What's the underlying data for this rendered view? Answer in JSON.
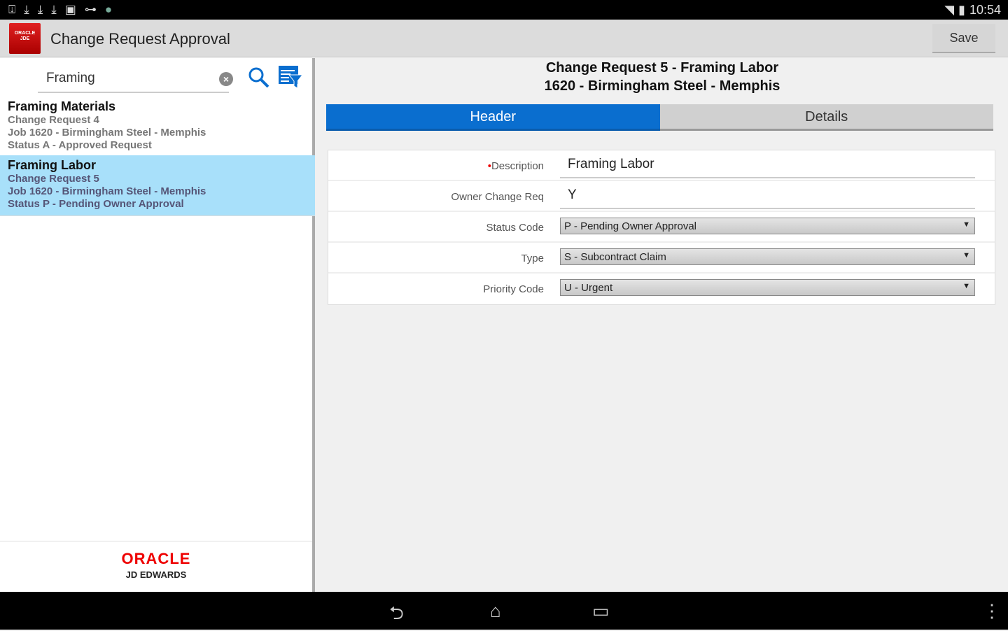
{
  "status_bar": {
    "time": "10:54",
    "icons": [
      "download-box-icon",
      "download-icon",
      "download-icon",
      "download-icon",
      "image-icon",
      "key-icon",
      "globe-icon"
    ]
  },
  "app": {
    "title": "Change Request Approval",
    "logo_text": "ORACLE JD EDWARDS ENTERPRISEONE",
    "save_label": "Save"
  },
  "search": {
    "value": "Framing"
  },
  "list": [
    {
      "title": "Framing Materials",
      "line1": "Change Request 4",
      "line2": "Job 1620 - Birmingham Steel - Memphis",
      "line3": "Status A - Approved Request",
      "selected": false
    },
    {
      "title": "Framing Labor",
      "line1": "Change Request 5",
      "line2": "Job 1620 - Birmingham Steel - Memphis",
      "line3": "Status P - Pending Owner Approval",
      "selected": true
    }
  ],
  "footer": {
    "brand": "ORACLE",
    "sub": "JD EDWARDS"
  },
  "detail": {
    "title1": "Change Request 5 - Framing Labor",
    "title2": "1620 - Birmingham Steel - Memphis",
    "tabs": [
      {
        "label": "Header"
      },
      {
        "label": "Details"
      }
    ],
    "fields": {
      "description": {
        "label": "Description",
        "value": "Framing Labor"
      },
      "owner": {
        "label": "Owner Change Req",
        "value": "Y"
      },
      "status": {
        "label": "Status Code",
        "value": "P - Pending Owner Approval"
      },
      "type": {
        "label": "Type",
        "value": "S - Subcontract Claim"
      },
      "priority": {
        "label": "Priority Code",
        "value": "U - Urgent"
      }
    }
  },
  "colors": {
    "accent": "#0a6ecf",
    "selected_row": "#a8e0fa",
    "required": "#e00000"
  }
}
